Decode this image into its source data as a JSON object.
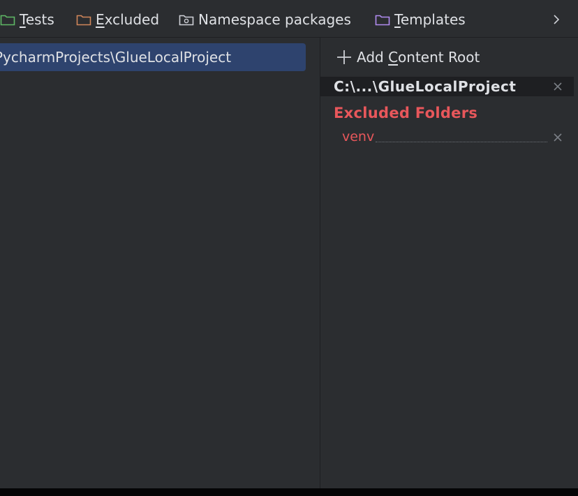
{
  "toolbar": {
    "items": [
      {
        "key": "T",
        "rest": "ests",
        "icon": "folder-green-icon",
        "color": "#5fb865"
      },
      {
        "key": "E",
        "rest": "xcluded",
        "icon": "folder-orange-icon",
        "color": "#d1865a"
      },
      {
        "key": "",
        "rest": "Namespace packages",
        "icon": "folder-namespace-icon",
        "color": "#ced0d6"
      },
      {
        "key": "T",
        "rest": "emplates",
        "icon": "folder-purple-icon",
        "color": "#b18cf0"
      }
    ],
    "more_icon": "chevron-right-icon"
  },
  "left": {
    "root_path": "PycharmProjects\\GlueLocalProject"
  },
  "right": {
    "add_root": {
      "before": "Add ",
      "key": "C",
      "after": "ontent Root"
    },
    "root_header": "C:\\...\\GlueLocalProject",
    "excluded_title": "Excluded Folders",
    "excluded_items": [
      "venv"
    ]
  },
  "colors": {
    "background": "#2b2d30",
    "selection": "#2e436e",
    "excluded": "#e8575b"
  }
}
